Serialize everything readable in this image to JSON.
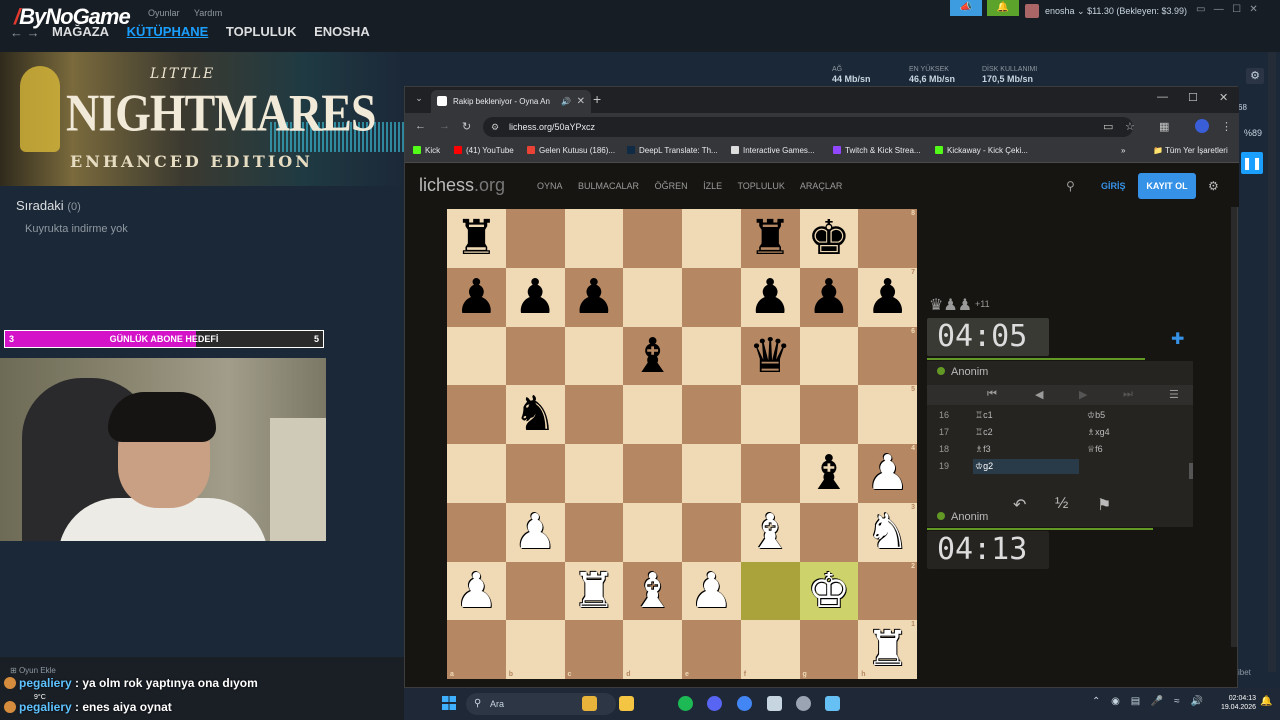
{
  "steam": {
    "logo": "ByNoGame",
    "mini_menu": [
      "Oyunlar",
      "Yardım"
    ],
    "nav": [
      "MAĞAZA",
      "KÜTÜPHANE",
      "TOPLULUK",
      "ENOSHA"
    ],
    "account": "enosha ⌄ $11.30 (Bekleyen: $3.99)",
    "stats": [
      {
        "label": "AĞ",
        "value": "44 Mb/sn"
      },
      {
        "label": "EN YÜKSEK",
        "value": "46,6 Mb/sn"
      },
      {
        "label": "DİSK KULLANIMI",
        "value": "170,5 Mb/sn"
      }
    ],
    "banner": {
      "line1": "LITTLE",
      "line2": "NIGHTMARES",
      "line3": "ENHANCED EDITION"
    },
    "queue_title": "Sıradaki",
    "queue_count": "(0)",
    "queue_empty": "Kuyrukta indirme yok",
    "add_game": "Oyun Ekle",
    "right_fragments": [
      "68",
      "%89",
      "ibet"
    ]
  },
  "sub_goal": {
    "label": "GÜNLÜK ABONE HEDEFİ",
    "current": "3",
    "max": "5",
    "progress": 0.6
  },
  "chat": [
    {
      "user": "pegaliery",
      "message": " : ya olm rok yaptınya ona dıyom"
    },
    {
      "user": "pegaliery",
      "message": " : enes aiya oynat"
    }
  ],
  "weather": "9°C",
  "browser": {
    "tab_title": "Rakip bekleniyor - Oyna An",
    "url": "lichess.org/50aYPxcz",
    "bookmarks": [
      {
        "label": "Kick",
        "color": "#53fc18"
      },
      {
        "label": "(41) YouTube",
        "color": "#ff0000"
      },
      {
        "label": "Gelen Kutusu (186)...",
        "color": "#ea4335"
      },
      {
        "label": "DeepL Translate: Th...",
        "color": "#0f2b46"
      },
      {
        "label": "Interactive Games...",
        "color": "#dddddd"
      },
      {
        "label": "Twitch & Kick Strea...",
        "color": "#9146ff"
      },
      {
        "label": "Kickaway - Kick Çeki...",
        "color": "#53fc18"
      }
    ],
    "bookmarks_all": "Tüm Yer İşaretleri"
  },
  "lichess": {
    "logo_main": "lichess",
    "logo_tld": ".org",
    "nav": [
      "OYNA",
      "BULMACALAR",
      "ÖĞREN",
      "İZLE",
      "TOPLULUK",
      "ARAÇLAR"
    ],
    "login": "GİRİŞ",
    "signup": "KAYIT OL",
    "material_diff": "+11",
    "clock_top": "04:05",
    "clock_bottom": "04:13",
    "player_top": "Anonim",
    "player_bottom": "Anonim",
    "moves": [
      {
        "n": "16",
        "w": "♖c1",
        "b": "♔b5"
      },
      {
        "n": "17",
        "w": "♖c2",
        "b": "♗xg4"
      },
      {
        "n": "18",
        "w": "♗f3",
        "b": "♕f6"
      },
      {
        "n": "19",
        "w": "♔g2",
        "b": ""
      }
    ],
    "draw_symbol": "½",
    "files": [
      "a",
      "b",
      "c",
      "d",
      "e",
      "f",
      "g",
      "h"
    ],
    "ranks": [
      "8",
      "7",
      "6",
      "5",
      "4",
      "3",
      "2",
      "1"
    ]
  },
  "board": {
    "highlight": [
      "f2",
      "g2"
    ],
    "pieces": [
      {
        "sq": "a8",
        "glyph": "♜",
        "color": "b"
      },
      {
        "sq": "f8",
        "glyph": "♜",
        "color": "b"
      },
      {
        "sq": "g8",
        "glyph": "♚",
        "color": "b"
      },
      {
        "sq": "a7",
        "glyph": "♟",
        "color": "b"
      },
      {
        "sq": "b7",
        "glyph": "♟",
        "color": "b"
      },
      {
        "sq": "c7",
        "glyph": "♟",
        "color": "b"
      },
      {
        "sq": "f7",
        "glyph": "♟",
        "color": "b"
      },
      {
        "sq": "g7",
        "glyph": "♟",
        "color": "b"
      },
      {
        "sq": "h7",
        "glyph": "♟",
        "color": "b"
      },
      {
        "sq": "d6",
        "glyph": "♝",
        "color": "b"
      },
      {
        "sq": "f6",
        "glyph": "♛",
        "color": "b"
      },
      {
        "sq": "b5",
        "glyph": "♞",
        "color": "b"
      },
      {
        "sq": "g4",
        "glyph": "♝",
        "color": "b"
      },
      {
        "sq": "h4",
        "glyph": "♟",
        "color": "w"
      },
      {
        "sq": "b3",
        "glyph": "♟",
        "color": "w"
      },
      {
        "sq": "f3",
        "glyph": "♝",
        "color": "w"
      },
      {
        "sq": "h3",
        "glyph": "♞",
        "color": "w"
      },
      {
        "sq": "a2",
        "glyph": "♟",
        "color": "w"
      },
      {
        "sq": "c2",
        "glyph": "♜",
        "color": "w"
      },
      {
        "sq": "d2",
        "glyph": "♝",
        "color": "w"
      },
      {
        "sq": "e2",
        "glyph": "♟",
        "color": "w"
      },
      {
        "sq": "g2",
        "glyph": "♚",
        "color": "w"
      },
      {
        "sq": "h1",
        "glyph": "♜",
        "color": "w"
      }
    ]
  },
  "taskbar": {
    "search": "Ara",
    "time": "02:04:13",
    "date": "19.04.2026",
    "apps": [
      {
        "name": "chrome-icon",
        "color": "#e8b33a"
      },
      {
        "name": "folder-icon",
        "color": "#f4c542"
      },
      {
        "name": "spotify-icon",
        "color": "#1db954"
      },
      {
        "name": "discord-icon",
        "color": "#5865f2"
      },
      {
        "name": "chrome-active-icon",
        "color": "#4285f4"
      },
      {
        "name": "steam-app-icon",
        "color": "#c7d5e0"
      },
      {
        "name": "settings-app-icon",
        "color": "#9aa4b2"
      },
      {
        "name": "steam-tray-app-icon",
        "color": "#66c0f4"
      }
    ]
  }
}
